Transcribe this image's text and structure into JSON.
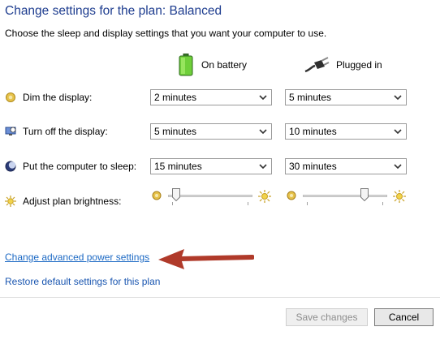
{
  "title": "Change settings for the plan: Balanced",
  "subtitle": "Choose the sleep and display settings that you want your computer to use.",
  "columns": {
    "battery": {
      "label": "On battery",
      "icon": "battery-icon"
    },
    "plugged": {
      "label": "Plugged in",
      "icon": "power-plug-icon"
    }
  },
  "rows": [
    {
      "label": "Dim the display:",
      "icon": "dim-display-icon",
      "battery": "2 minutes",
      "plugged": "5 minutes"
    },
    {
      "label": "Turn off the display:",
      "icon": "monitor-icon",
      "battery": "5 minutes",
      "plugged": "10 minutes"
    },
    {
      "label": "Put the computer to sleep:",
      "icon": "sleep-moon-icon",
      "battery": "15 minutes",
      "plugged": "30 minutes"
    }
  ],
  "brightness": {
    "label": "Adjust plan brightness:",
    "icon": "brightness-icon",
    "battery_level": 0.05,
    "plugged_level": 0.75
  },
  "links": {
    "advanced": "Change advanced power settings",
    "restore": "Restore default settings for this plan"
  },
  "buttons": {
    "save": "Save changes",
    "cancel": "Cancel"
  },
  "colors": {
    "title": "#1e3d8f",
    "link": "#1c69c4",
    "annotation_arrow": "#b03a2a"
  }
}
